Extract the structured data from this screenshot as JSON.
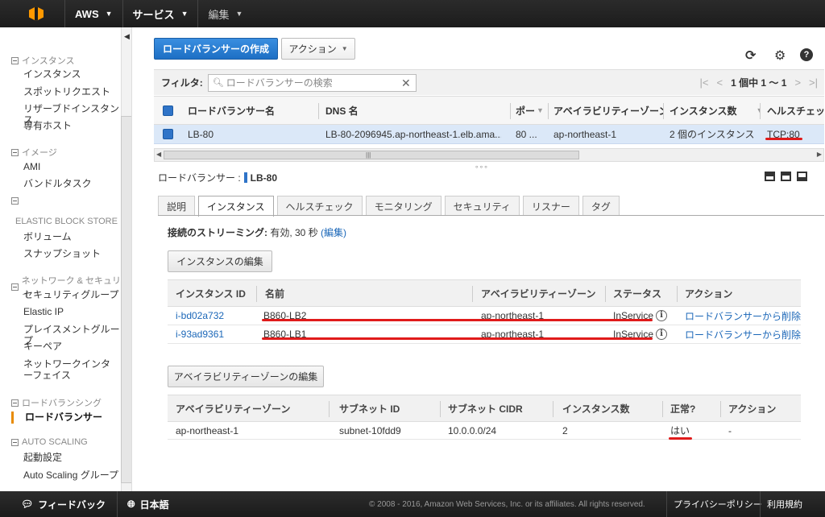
{
  "topbar": {
    "brand": "AWS",
    "services": "サービス",
    "edit": "編集"
  },
  "sidebar": {
    "sections": [
      {
        "label": "インスタンス"
      },
      {
        "label": "イメージ"
      },
      {
        "label": "ELASTIC BLOCK STORE"
      },
      {
        "label": "ネットワーク & セキュリティ"
      },
      {
        "label": "ロードバランシング"
      },
      {
        "label": "AUTO SCALING"
      }
    ],
    "items": {
      "instances": "インスタンス",
      "spot": "スポットリクエスト",
      "reserved": "リザーブドインスタンス",
      "dedicated": "専有ホスト",
      "ami": "AMI",
      "bundle": "バンドルタスク",
      "volumes": "ボリューム",
      "snapshots": "スナップショット",
      "security_groups": "セキュリティグループ",
      "elastic_ip": "Elastic IP",
      "placement": "プレイスメントグループ",
      "keypairs": "キーペア",
      "eni": "ネットワークインターフェイス",
      "lb": "ロードバランサー",
      "launch_config": "起動設定",
      "asg": "Auto Scaling グループ"
    }
  },
  "toolbar": {
    "create": "ロードバランサーの作成",
    "actions": "アクション"
  },
  "filter": {
    "label": "フィルタ:",
    "placeholder": "ロードバランサーの検索",
    "pager": "1 個中 1 〜 1"
  },
  "grid": {
    "headers": {
      "name": "ロードバランサー名",
      "dns": "DNS 名",
      "port": "ポー",
      "az": "アベイラビリティーゾーン",
      "instances": "インスタンス数",
      "health": "ヘルスチェッ"
    },
    "row": {
      "name": "LB-80",
      "dns": "LB-80-2096945.ap-northeast-1.elb.ama...",
      "port": "80 ...",
      "az": "ap-northeast-1",
      "instances": "2 個のインスタンス",
      "health": "TCP:80"
    }
  },
  "hscroll_grip": "|||",
  "detail": {
    "label": "ロードバランサー :",
    "name": "LB-80"
  },
  "tabs": [
    "説明",
    "インスタンス",
    "ヘルスチェック",
    "モニタリング",
    "セキュリティ",
    "リスナー",
    "タグ"
  ],
  "stream": {
    "label": "接続のストリーミング:",
    "value": "有効, 30 秒",
    "edit": "(編集)"
  },
  "edit_instances_button": "インスタンスの編集",
  "instances_table": {
    "headers": {
      "id": "インスタンス ID",
      "name": "名前",
      "az": "アベイラビリティーゾーン",
      "status": "ステータス",
      "action": "アクション"
    },
    "rows": [
      {
        "id": "i-bd02a732",
        "name": "B860-LB2",
        "az": "ap-northeast-1",
        "status": "InService",
        "action": "ロードバランサーから削除"
      },
      {
        "id": "i-93ad9361",
        "name": "B860-LB1",
        "az": "ap-northeast-1",
        "status": "InService",
        "action": "ロードバランサーから削除"
      }
    ]
  },
  "edit_az_button": "アベイラビリティーゾーンの編集",
  "az_table": {
    "headers": {
      "az": "アベイラビリティーゾーン",
      "subnet": "サブネット ID",
      "cidr": "サブネット CIDR",
      "count": "インスタンス数",
      "healthy": "正常?",
      "action": "アクション"
    },
    "rows": [
      {
        "az": "ap-northeast-1",
        "subnet": "subnet-10fdd9",
        "cidr": "10.0.0.0/24",
        "count": "2",
        "healthy": "はい",
        "action": "-"
      }
    ]
  },
  "footer": {
    "feedback": "フィードバック",
    "language": "日本語",
    "copyright": "© 2008 - 2016, Amazon Web Services, Inc. or its affiliates. All rights reserved.",
    "privacy": "プライバシーポリシー",
    "terms": "利用規約"
  },
  "annotation_color": "#e01b1b",
  "accent_color": "#2f74c8"
}
